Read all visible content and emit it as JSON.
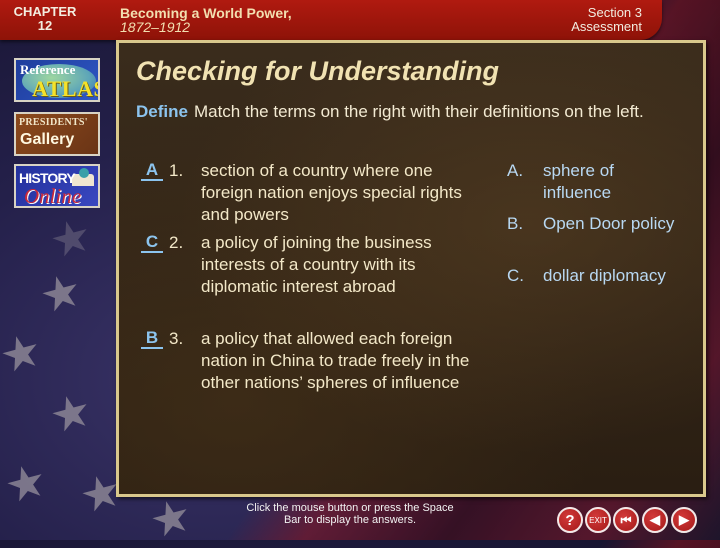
{
  "header": {
    "chapter_label": "CHAPTER",
    "chapter_number": "12",
    "book_title": "Becoming a World Power,",
    "book_years": "1872–1912",
    "section": "Section 3",
    "section_type": "Assessment"
  },
  "sidebar": {
    "atlas": {
      "line1": "Reference",
      "line2": "ATLAS"
    },
    "gallery": {
      "line1": "PRESIDENTS'",
      "line2": "Gallery"
    },
    "history": {
      "line1": "HISTORY",
      "line2": "Online"
    }
  },
  "main": {
    "title": "Checking for Understanding",
    "define_label": "Define",
    "instructions": "Match the terms on the right with their definitions on the left.",
    "definitions": [
      {
        "answer": "A",
        "number": "1.",
        "text": "section of a country where one foreign nation enjoys special rights and powers"
      },
      {
        "answer": "C",
        "number": "2.",
        "text": "a policy of joining the business interests of a country with its diplomatic interest abroad"
      },
      {
        "answer": "B",
        "number": "3.",
        "text": "a policy that allowed each foreign nation in China to trade freely in the other nations’ spheres of influence"
      }
    ],
    "terms": [
      {
        "letter": "A.",
        "text": "sphere of influence"
      },
      {
        "letter": "B.",
        "text": "Open Door policy"
      },
      {
        "letter": "C.",
        "text": "dollar diplomacy"
      }
    ]
  },
  "footer": {
    "hint": "Click the mouse button or press the Space Bar to display the answers.",
    "nav": {
      "help": "?",
      "exit": "EXIT",
      "first": "⏮",
      "prev": "◀",
      "next": "▶"
    }
  },
  "colors": {
    "header_red": "#9e160c",
    "title_cream": "#f1e2b2",
    "answer_blue": "#8cc4ee",
    "frame_gold": "#d9c88c"
  }
}
